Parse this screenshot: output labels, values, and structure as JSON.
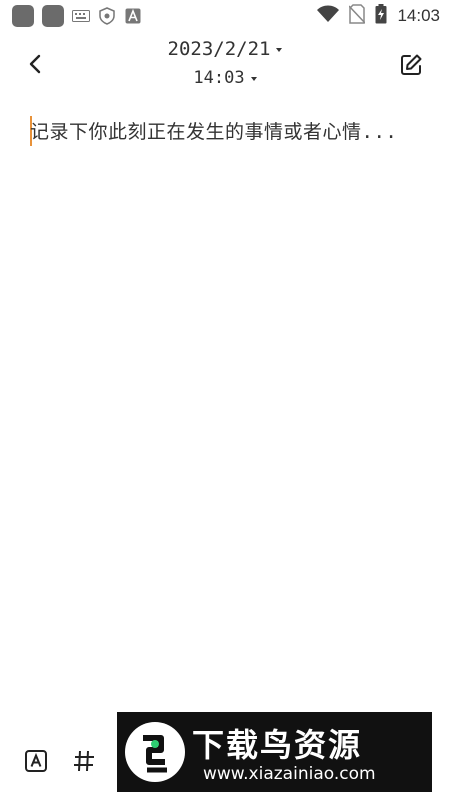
{
  "status_bar": {
    "time": "14:03"
  },
  "header": {
    "date": "2023/2/21",
    "time": "14:03"
  },
  "editor": {
    "placeholder": "记录下你此刻正在发生的事情或者心情..."
  },
  "toolbar": {
    "format_icon": "text-format-icon",
    "tag_icon": "hashtag-icon"
  },
  "watermark": {
    "title": "下载鸟资源",
    "url": "www.xiazainiao.com"
  },
  "colors": {
    "cursor": "#e8923a",
    "text": "#333333"
  }
}
